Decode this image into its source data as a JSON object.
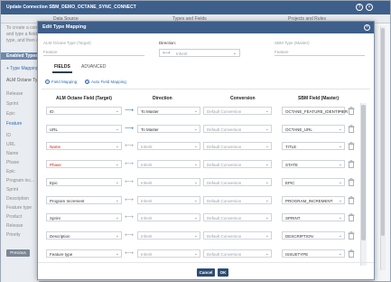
{
  "background": {
    "title": "Update Connection SBM_DEMO_OCTANE_SYNC_CONNECT",
    "tabs": [
      "Data Source",
      "Types and Fields",
      "Projects and Rules"
    ],
    "hint_lines": [
      "To create a conn...",
      "and type a field to",
      "type, and then a..."
    ],
    "enabled_types": "Enabled Types",
    "type_mapping_link": "+ Type Mapping",
    "left_header": "ALM Octane Type",
    "left_types": [
      "Release",
      "Sprint",
      "Epic",
      "Feature"
    ],
    "left_fields": [
      "ID",
      "URL",
      "Name",
      "Phase",
      "Epic",
      "Program inc...",
      "Sprint",
      "Description",
      "Feature type",
      "Product",
      "Release",
      "Priority"
    ],
    "prev_button": "Previous"
  },
  "dialog": {
    "title": "Edit Type Mapping",
    "octane_type_label": "ALM Octane Type (Target)",
    "octane_type_value": "Feature",
    "direction_label": "Direction:",
    "direction_value": "Inherit",
    "sbm_type_label": "SBM Type (Master)",
    "sbm_type_value": "Feature",
    "tabs": {
      "fields": "FIELDS",
      "advanced": "ADVANCED"
    },
    "toolbar": {
      "field_mapping": "Field Mapping",
      "auto_field_mapping": "Auto Field Mapping"
    },
    "columns": {
      "octane": "ALM Octane Field (Target)",
      "direction": "Direction",
      "conversion": "Conversion",
      "sbm": "SBM Field (Master)"
    },
    "rows": [
      {
        "octane": "ID",
        "direction": "To Master",
        "conversion": "Default Conversion",
        "sbm": "OCTANE_FEATURE_IDENTIFIER",
        "required": false,
        "inherit": false
      },
      {
        "octane": "URL",
        "direction": "To Master",
        "conversion": "Default Conversion",
        "sbm": "OCTANE_URL",
        "required": false,
        "inherit": false
      },
      {
        "octane": "Name",
        "direction": "Inherit",
        "conversion": "Default Conversion",
        "sbm": "TITLE",
        "required": true,
        "inherit": true
      },
      {
        "octane": "Phase",
        "direction": "Inherit",
        "conversion": "Default Conversion",
        "sbm": "STATE",
        "required": true,
        "inherit": true
      },
      {
        "octane": "Epic",
        "direction": "Inherit",
        "conversion": "Default Conversion",
        "sbm": "EPIC",
        "required": false,
        "inherit": true
      },
      {
        "octane": "Program Increment",
        "direction": "Inherit",
        "conversion": "Default Conversion",
        "sbm": "PROGRAM_INCREMENT",
        "required": false,
        "inherit": true
      },
      {
        "octane": "Sprint",
        "direction": "Inherit",
        "conversion": "Default Conversion",
        "sbm": "SPRINT",
        "required": false,
        "inherit": true
      },
      {
        "octane": "Description",
        "direction": "Inherit",
        "conversion": "Default Conversion",
        "sbm": "DESCRIPTION",
        "required": false,
        "inherit": true
      },
      {
        "octane": "Feature type",
        "direction": "Inherit",
        "conversion": "Default Conversion",
        "sbm": "ISSUETYPE",
        "required": false,
        "inherit": true
      }
    ],
    "cancel": "Cancel",
    "ok": "OK"
  },
  "colors": {
    "titlebar": "#3e5f8a",
    "required_field": "#d21d1d",
    "to_master_arrow": "#2e6eb5",
    "inherit_arrow": "#9aa5b3",
    "button": "#2d4c74"
  }
}
